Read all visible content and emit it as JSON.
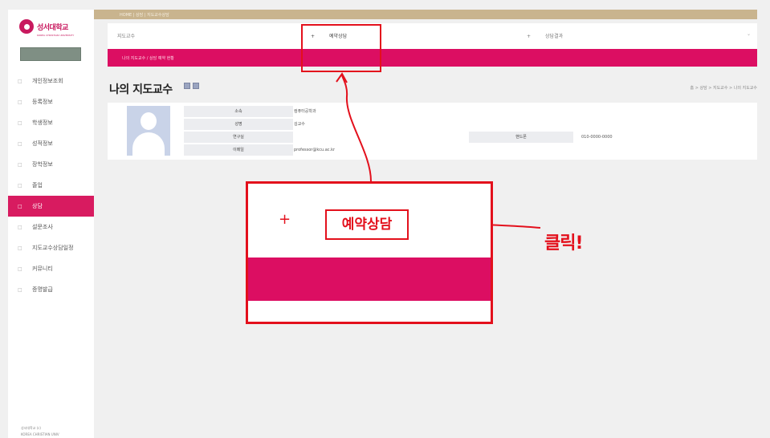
{
  "sidebar": {
    "logo_text": "성서대학교",
    "logo_subtitle": "KOREA CHRISTIAN UNIVERSITY",
    "items": [
      {
        "label": "개인정보조회",
        "active": false
      },
      {
        "label": "등록정보",
        "active": false
      },
      {
        "label": "학생정보",
        "active": false
      },
      {
        "label": "성적정보",
        "active": false
      },
      {
        "label": "장학정보",
        "active": false
      },
      {
        "label": "졸업",
        "active": false
      },
      {
        "label": "상담",
        "active": true
      },
      {
        "label": "설문조사",
        "active": false
      },
      {
        "label": "지도교수상담일정",
        "active": false
      },
      {
        "label": "커뮤니티",
        "active": false
      },
      {
        "label": "증명발급",
        "active": false
      }
    ],
    "footer_lines": [
      "성서대학교 (c)",
      "KOREA CHRISTIAN UNIV"
    ]
  },
  "top_band": {
    "crumbs": "HOME  |  상담  |  지도교수상담"
  },
  "tabs": {
    "tab1": "지도교수",
    "tab2_plus": "+",
    "tab2": "예약상담",
    "tab3_plus": "+",
    "tab3": "상담결과"
  },
  "pink_bar": {
    "crumbs": "나의 지도교수   /   상담 예약 현황"
  },
  "page": {
    "title": "나의 지도교수",
    "right_crumbs": "홈 > 상담 > 지도교수 > 나의 지도교수"
  },
  "profile": {
    "rows": [
      {
        "label": "소속",
        "value": "컴퓨터공학과"
      },
      {
        "label": "성명",
        "value": "김교수"
      },
      {
        "label": "연구실",
        "value": ""
      },
      {
        "label": "이메일",
        "value": "professor@kcu.ac.kr"
      }
    ],
    "phone_label": "핸드폰",
    "phone_value": "010-0000-0000"
  },
  "annotation": {
    "zoom_plus": "+",
    "zoom_label": "예약상담",
    "click_text": "클릭!",
    "color": "#e3101c"
  },
  "colors": {
    "accent_pink": "#dc0e62",
    "top_band": "#c9b48e",
    "annotation_red": "#e3101c"
  }
}
